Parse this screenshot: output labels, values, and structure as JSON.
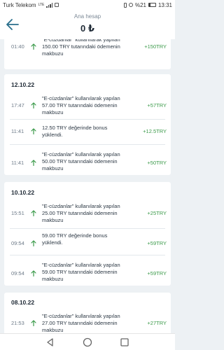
{
  "status_bar": {
    "carrier": "Turk Telekom",
    "network": "LTE",
    "battery": "%21",
    "time": "13:31"
  },
  "header": {
    "title": "Ana hesap",
    "balance": "0 ₺"
  },
  "icons": {
    "back": "arrow-left-icon",
    "transaction": "arrow-up-icon",
    "nav_back": "triangle-back-icon",
    "nav_home": "circle-home-icon",
    "nav_recent": "square-recent-icon"
  },
  "colors": {
    "accent": "#3b9a4a",
    "header_icon": "#2a6f8c",
    "background": "#edf1f4"
  },
  "days": [
    {
      "date": "",
      "transactions": [
        {
          "time": "01:40",
          "description": "\"E-cüzdanlar\" kullanılarak yapılan 150.00 TRY tutarındaki ödemenin makbuzu",
          "amount": "+150TRY"
        }
      ]
    },
    {
      "date": "12.10.22",
      "transactions": [
        {
          "time": "17:47",
          "description": "\"E-cüzdanlar\" kullanılarak yapılan 57.00 TRY tutarındaki ödemenin makbuzu",
          "amount": "+57TRY"
        },
        {
          "time": "11:41",
          "description": "12.50 TRY değerinde bonus yüklendi.",
          "amount": "+12.5TRY"
        },
        {
          "time": "11:41",
          "description": "\"E-cüzdanlar\" kullanılarak yapılan 50.00 TRY tutarındaki ödemenin makbuzu",
          "amount": "+50TRY"
        }
      ]
    },
    {
      "date": "10.10.22",
      "transactions": [
        {
          "time": "15:51",
          "description": "\"E-cüzdanlar\" kullanılarak yapılan 25.00 TRY tutarındaki ödemenin makbuzu",
          "amount": "+25TRY"
        },
        {
          "time": "09:54",
          "description": "59.00 TRY değerinde bonus yüklendi.",
          "amount": "+59TRY"
        },
        {
          "time": "09:54",
          "description": "\"E-cüzdanlar\" kullanılarak yapılan 59.00 TRY tutarındaki ödemenin makbuzu",
          "amount": "+59TRY"
        }
      ]
    },
    {
      "date": "08.10.22",
      "transactions": [
        {
          "time": "21:53",
          "description": "\"E-cüzdanlar\" kullanılarak yapılan 27.00 TRY tutarındaki ödemenin makbuzu",
          "amount": "+27TRY"
        }
      ]
    }
  ]
}
